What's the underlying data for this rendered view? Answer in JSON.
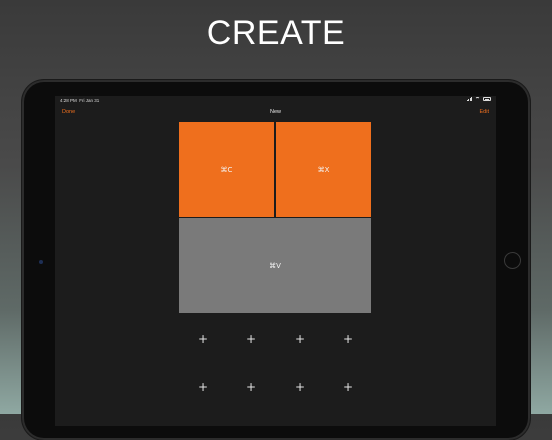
{
  "headline": "CREATE",
  "status_bar": {
    "time": "4:28 PM",
    "date": "Fri Jan 31",
    "icons": [
      "signal-icon",
      "wifi-icon",
      "battery-icon"
    ]
  },
  "nav": {
    "left_label": "Done",
    "title": "New",
    "right_label": "Edit"
  },
  "tiles": [
    {
      "label": "⌘C",
      "color": "#ef6f1d"
    },
    {
      "label": "⌘X",
      "color": "#ef6f1d"
    },
    {
      "label": "⌘V",
      "color": "#7a7a7a"
    }
  ],
  "add_slot_symbol": "+",
  "colors": {
    "accent": "#f0701f",
    "screen_background": "#1c1c1c"
  }
}
